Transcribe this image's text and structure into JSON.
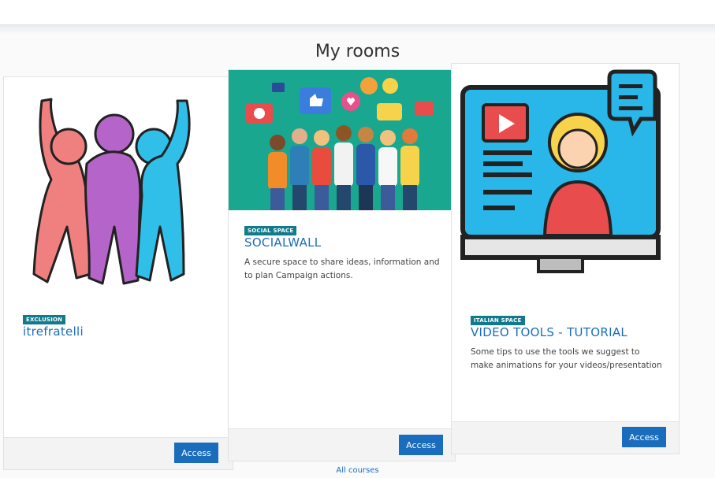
{
  "page": {
    "title": "My rooms",
    "all_courses": "All courses"
  },
  "rooms": [
    {
      "badge": "EXCLUSION",
      "title": "itrefratelli",
      "description": "",
      "button": "Access"
    },
    {
      "badge": "SOCIAL SPACE",
      "title": "SOCIALWALL",
      "description": "A secure space to share ideas, information and to plan Campaign actions.",
      "button": "Access"
    },
    {
      "badge": "ITALIAN SPACE",
      "title": "VIDEO TOOLS - TUTORIAL",
      "description": "Some tips to use the tools we suggest to make animations for your videos/presentation",
      "button": "Access"
    }
  ],
  "colors": {
    "accent": "#1a6dbd",
    "badge": "#117a8b",
    "social_bg": "#19a88f",
    "video_bg": "#29b6e8"
  }
}
